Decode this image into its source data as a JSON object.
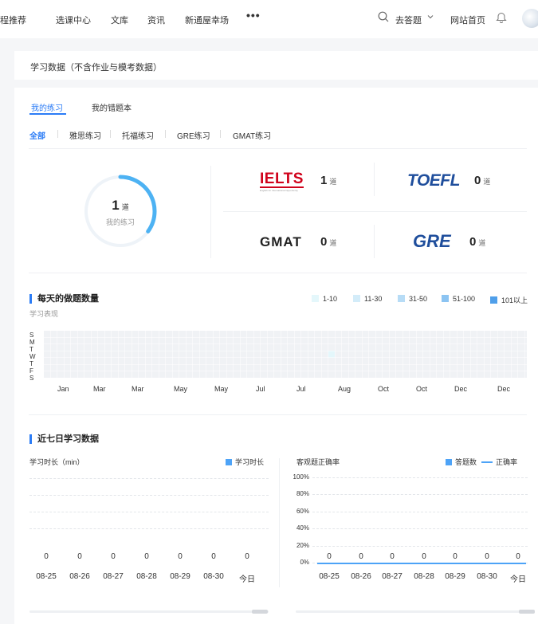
{
  "nav": {
    "items": [
      "程推荐",
      "选课中心",
      "文库",
      "资讯",
      "新通屋幸场"
    ],
    "more": "•••",
    "ask": "去答题",
    "home": "网站首页"
  },
  "header": {
    "title": "学习数据（不含作业与模考数据）"
  },
  "tabs": {
    "practice": "我的练习",
    "wrongbook": "我的错题本"
  },
  "subtabs": [
    "全部",
    "雅思练习",
    "托福练习",
    "GRE练习",
    "GMAT练习"
  ],
  "summary": {
    "count": "1",
    "unit": "道",
    "label": "我的练习",
    "progress": 0.35
  },
  "exams": {
    "ielts": {
      "logo": "IELTS",
      "tagline": "English for International Opportunity",
      "count": "1",
      "unit": "道"
    },
    "toefl": {
      "logo": "TOEFL",
      "count": "0",
      "unit": "道"
    },
    "gmat": {
      "logo": "GMAT",
      "count": "0",
      "unit": "道"
    },
    "gre": {
      "logo": "GRE",
      "count": "0",
      "unit": "道"
    }
  },
  "daily": {
    "title": "每天的做题数量",
    "subtitle": "学习表现",
    "legend": [
      {
        "label": "1-10",
        "color": "#e4f7fb"
      },
      {
        "label": "11-30",
        "color": "#d3ecf9"
      },
      {
        "label": "31-50",
        "color": "#b7dcf6"
      },
      {
        "label": "51-100",
        "color": "#8cc4f2"
      },
      {
        "label": "101以上",
        "color": "#4f9fea"
      }
    ],
    "day_labels": [
      "S",
      "M",
      "T",
      "W",
      "T",
      "F",
      "S"
    ],
    "months": [
      "Jan",
      "Mar",
      "Mar",
      "May",
      "May",
      "Jul",
      "Jul",
      "Aug",
      "Oct",
      "Oct",
      "Dec",
      "Dec"
    ],
    "empty_color": "#f0f2f5",
    "active_color": "#e4f7fb"
  },
  "recent": {
    "title": "近七日学习数据",
    "study_time": {
      "title": "学习时长（min）",
      "legend": "学习时长",
      "values": [
        "0",
        "0",
        "0",
        "0",
        "0",
        "0",
        "0"
      ]
    },
    "accuracy": {
      "title": "客观题正确率",
      "legend_bar": "答题数",
      "legend_line": "正确率",
      "y_ticks": [
        "100%",
        "80%",
        "60%",
        "40%",
        "20%",
        "0%"
      ],
      "values": [
        "0",
        "0",
        "0",
        "0",
        "0",
        "0",
        "0"
      ]
    },
    "dates": [
      "08-25",
      "08-26",
      "08-27",
      "08-28",
      "08-29",
      "08-30",
      "今日"
    ]
  }
}
